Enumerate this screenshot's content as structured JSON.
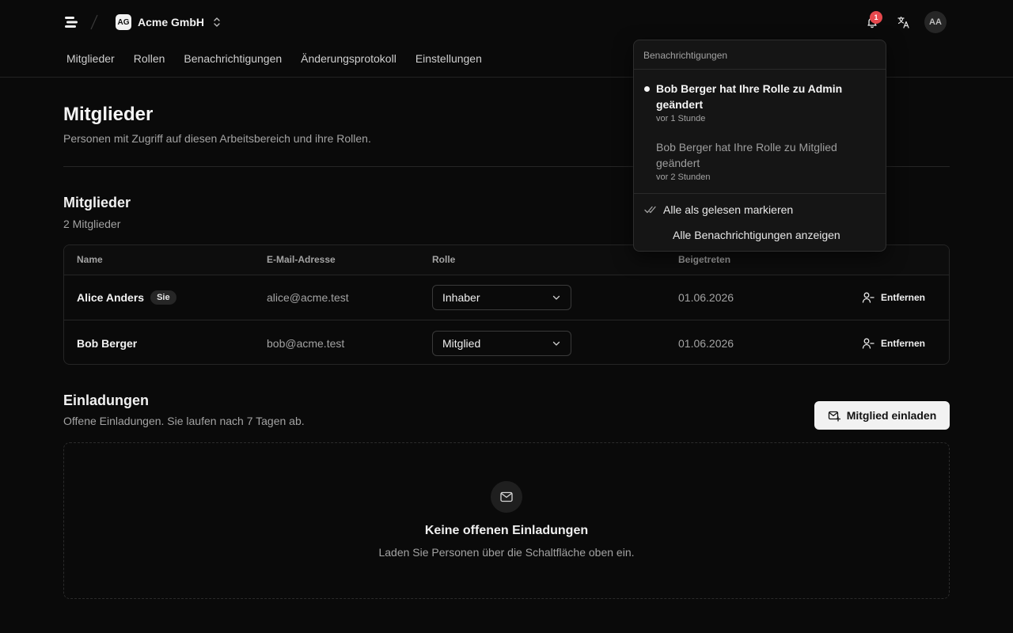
{
  "header": {
    "org_initials": "AG",
    "org_name": "Acme GmbH",
    "notification_count": "1",
    "user_initials": "AA"
  },
  "tabs": [
    {
      "label": "Mitglieder"
    },
    {
      "label": "Rollen"
    },
    {
      "label": "Benachrichtigungen"
    },
    {
      "label": "Änderungsprotokoll"
    },
    {
      "label": "Einstellungen"
    }
  ],
  "page": {
    "title": "Mitglieder",
    "subtitle": "Personen mit Zugriff auf diesen Arbeitsbereich und ihre Rollen."
  },
  "members": {
    "title": "Mitglieder",
    "count_label": "2 Mitglieder",
    "columns": [
      "Name",
      "E-Mail-Adresse",
      "Rolle",
      "Beigetreten"
    ],
    "rows": [
      {
        "name": "Alice Anders",
        "badge": "Sie",
        "email": "alice@acme.test",
        "role": "Inhaber",
        "joined": "01.06.2026",
        "remove": "Entfernen"
      },
      {
        "name": "Bob Berger",
        "badge": "",
        "email": "bob@acme.test",
        "role": "Mitglied",
        "joined": "01.06.2026",
        "remove": "Entfernen"
      }
    ]
  },
  "invitations": {
    "title": "Einladungen",
    "subtitle": "Offene Einladungen. Sie laufen nach 7 Tagen ab.",
    "invite_button": "Mitglied einladen",
    "empty_title": "Keine offenen Einladungen",
    "empty_subtitle": "Laden Sie Personen über die Schaltfläche oben ein."
  },
  "notifications": {
    "header": "Benachrichtigungen",
    "items": [
      {
        "text": "Bob Berger hat Ihre Rolle zu Admin geändert",
        "time": "vor 1 Stunde",
        "unread": true
      },
      {
        "text": "Bob Berger hat Ihre Rolle zu Mitglied geändert",
        "time": "vor 2 Stunden",
        "unread": false
      }
    ],
    "mark_all_read": "Alle als gelesen markieren",
    "view_all": "Alle Benachrichtigungen anzeigen"
  },
  "colors": {
    "background": "#0a0a0a",
    "badge_red": "#e5484d",
    "primary_button": "#f2f2f2"
  },
  "icons": [
    "logo-icon",
    "chevron-up-down-icon",
    "bell-icon",
    "translate-icon",
    "chevron-down-icon",
    "user-minus-icon",
    "mail-plus-icon",
    "mail-icon",
    "check-double-icon"
  ]
}
